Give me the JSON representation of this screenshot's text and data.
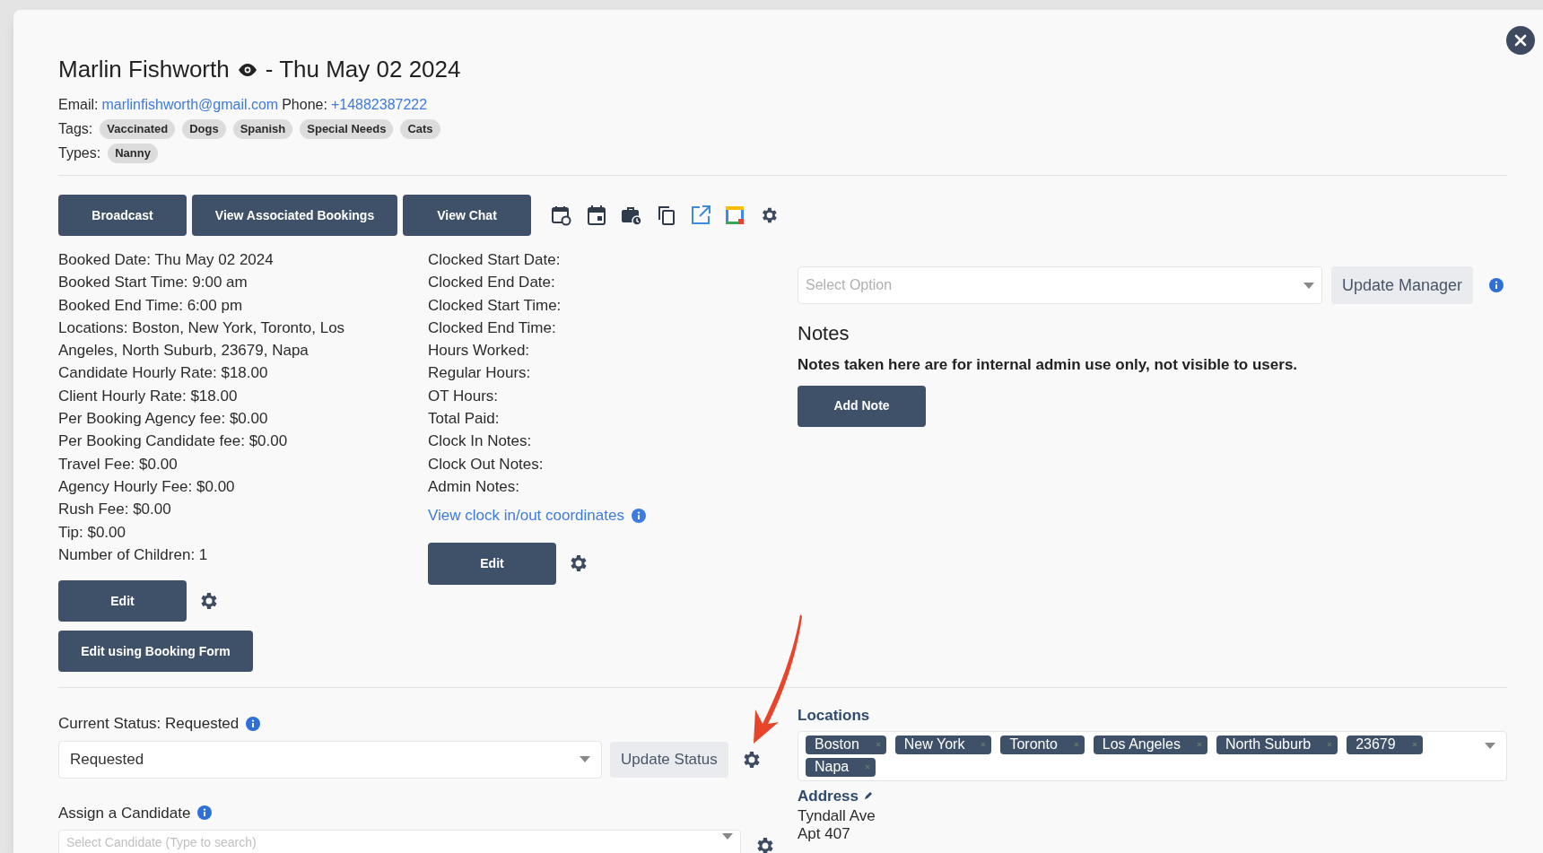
{
  "header": {
    "name": "Marlin Fishworth",
    "date_suffix": "- Thu May 02 2024",
    "email_label": "Email:",
    "email": "marlinfishworth@gmail.com",
    "phone_label": "Phone:",
    "phone": "+14882387222",
    "tags_label": "Tags:",
    "tags": [
      "Vaccinated",
      "Dogs",
      "Spanish",
      "Special Needs",
      "Cats"
    ],
    "types_label": "Types:",
    "types": [
      "Nanny"
    ]
  },
  "toolbar": {
    "buttons": [
      "Broadcast",
      "View Associated Bookings",
      "View Chat"
    ]
  },
  "booking_details": [
    "Booked Date: Thu May 02 2024",
    "Booked Start Time: 9:00 am",
    "Booked End Time: 6:00 pm",
    "Locations: Boston, New York, Toronto, Los Angeles, North Suburb, 23679, Napa",
    "Candidate Hourly Rate: $18.00",
    "Client Hourly Rate: $18.00",
    "Per Booking Agency fee: $0.00",
    "Per Booking Candidate fee: $0.00",
    "Travel Fee: $0.00",
    "Agency Hourly Fee: $0.00",
    "Rush Fee: $0.00",
    "Tip: $0.00",
    "Number of Children: 1"
  ],
  "booking_edit": {
    "edit_button": "Edit",
    "form_button": "Edit using Booking Form"
  },
  "clock_details": [
    "Clocked Start Date:",
    "Clocked End Date:",
    "Clocked Start Time:",
    "Clocked End Time:",
    "Hours Worked:",
    "Regular Hours:",
    "OT Hours:",
    "Total Paid:",
    "Clock In Notes:",
    "Clock Out Notes:",
    "Admin Notes:"
  ],
  "coordinates_link": "View clock in/out coordinates",
  "clock_edit_button": "Edit",
  "manager": {
    "placeholder": "Select Option",
    "button": "Update Manager"
  },
  "notes": {
    "title": "Notes",
    "notice": "Notes taken here are for internal admin use only, not visible to users.",
    "button": "Add Note"
  },
  "status": {
    "label": "Current Status: Requested",
    "value": "Requested",
    "button": "Update Status"
  },
  "candidate": {
    "label": "Assign a Candidate",
    "placeholder": "Select Candidate (Type to search)"
  },
  "locations": {
    "title": "Locations",
    "tags": [
      "Boston",
      "New York",
      "Toronto",
      "Los Angeles",
      "North Suburb",
      "23679",
      "Napa"
    ]
  },
  "address": {
    "title": "Address",
    "lines": [
      "Tyndall Ave",
      "Apt 407"
    ]
  }
}
